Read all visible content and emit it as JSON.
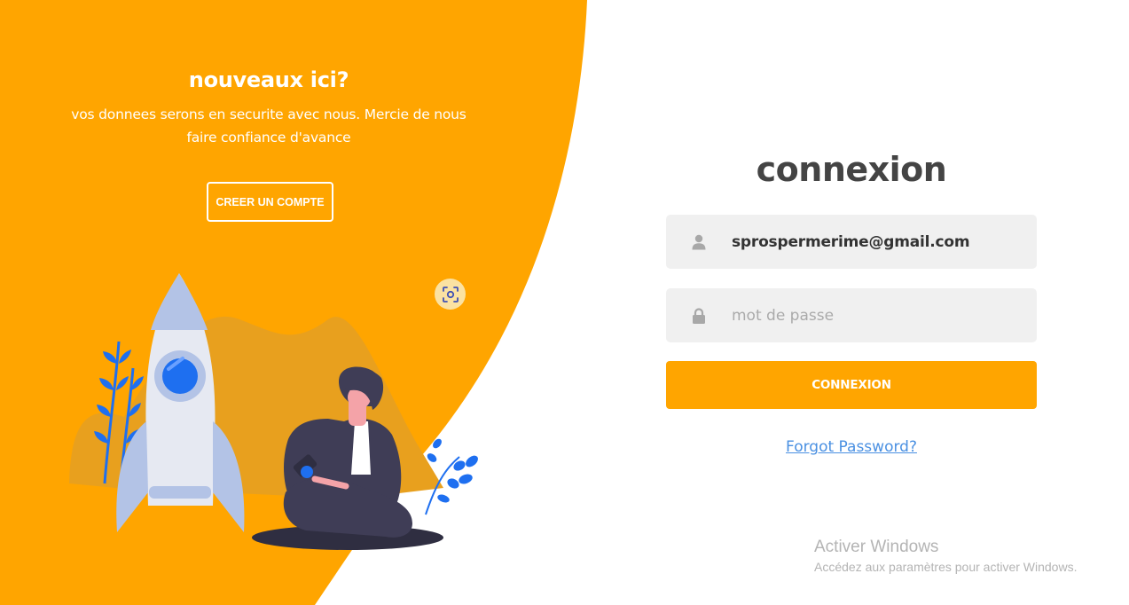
{
  "colors": {
    "primary": "#ffa500",
    "background": "#ffffff",
    "field_bg": "#f0f0f0",
    "title_text": "#444444",
    "link": "#4a90e2",
    "illustration_blue": "#1e6ff0",
    "illustration_purple": "#3f3d56"
  },
  "left_panel": {
    "title": "nouveaux ici?",
    "subtitle": "vos donnees serons en securite avec nous. Mercie de nous faire confiance d'avance",
    "create_account_button": "CREER UN COMPTE",
    "scan_icon": "scan-icon",
    "illustration": "rocket-and-person-illustration"
  },
  "login_form": {
    "title": "connexion",
    "email_field": {
      "icon": "user-icon",
      "value": "sprospermerime@gmail.com"
    },
    "password_field": {
      "icon": "lock-icon",
      "placeholder": "mot de passe",
      "value": ""
    },
    "submit_button": "CONNEXION",
    "forgot_link": "Forgot Password?"
  },
  "watermark": {
    "title": "Activer Windows",
    "subtitle": "Accédez aux paramètres pour activer Windows."
  }
}
